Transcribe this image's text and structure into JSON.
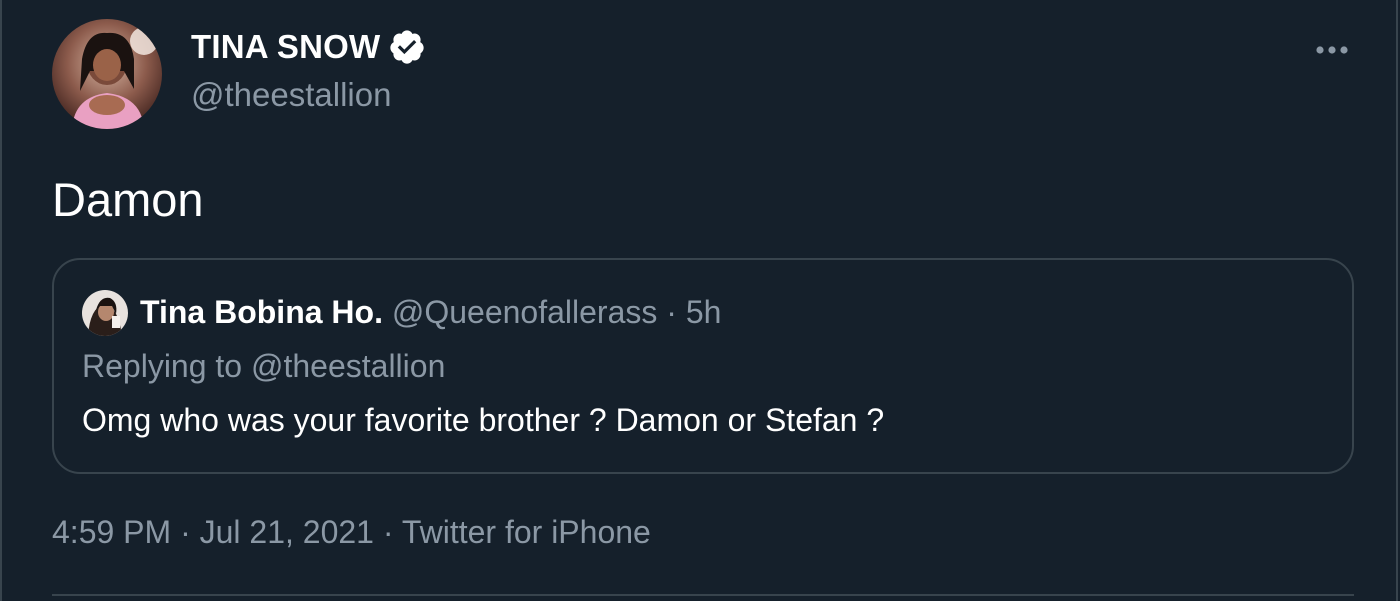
{
  "colors": {
    "background": "#15202b",
    "text_primary": "#ffffff",
    "text_secondary": "#8b98a5",
    "border": "#38444d"
  },
  "author": {
    "display_name": "TINA SNOW",
    "handle": "@theestallion",
    "verified": true
  },
  "tweet": {
    "text": "Damon"
  },
  "quoted_tweet": {
    "display_name": "Tina Bobina Ho.",
    "handle": "@Queenofallerass",
    "separator": " · ",
    "time": "5h",
    "replying_to": "Replying to @theestallion",
    "text": "Omg who was your favorite brother ? Damon or Stefan ?"
  },
  "meta": {
    "time": "4:59 PM",
    "date": "Jul 21, 2021",
    "source": "Twitter for iPhone",
    "separator": " · "
  },
  "icons": {
    "verified": "verified-badge-icon",
    "more": "more-options-icon"
  }
}
